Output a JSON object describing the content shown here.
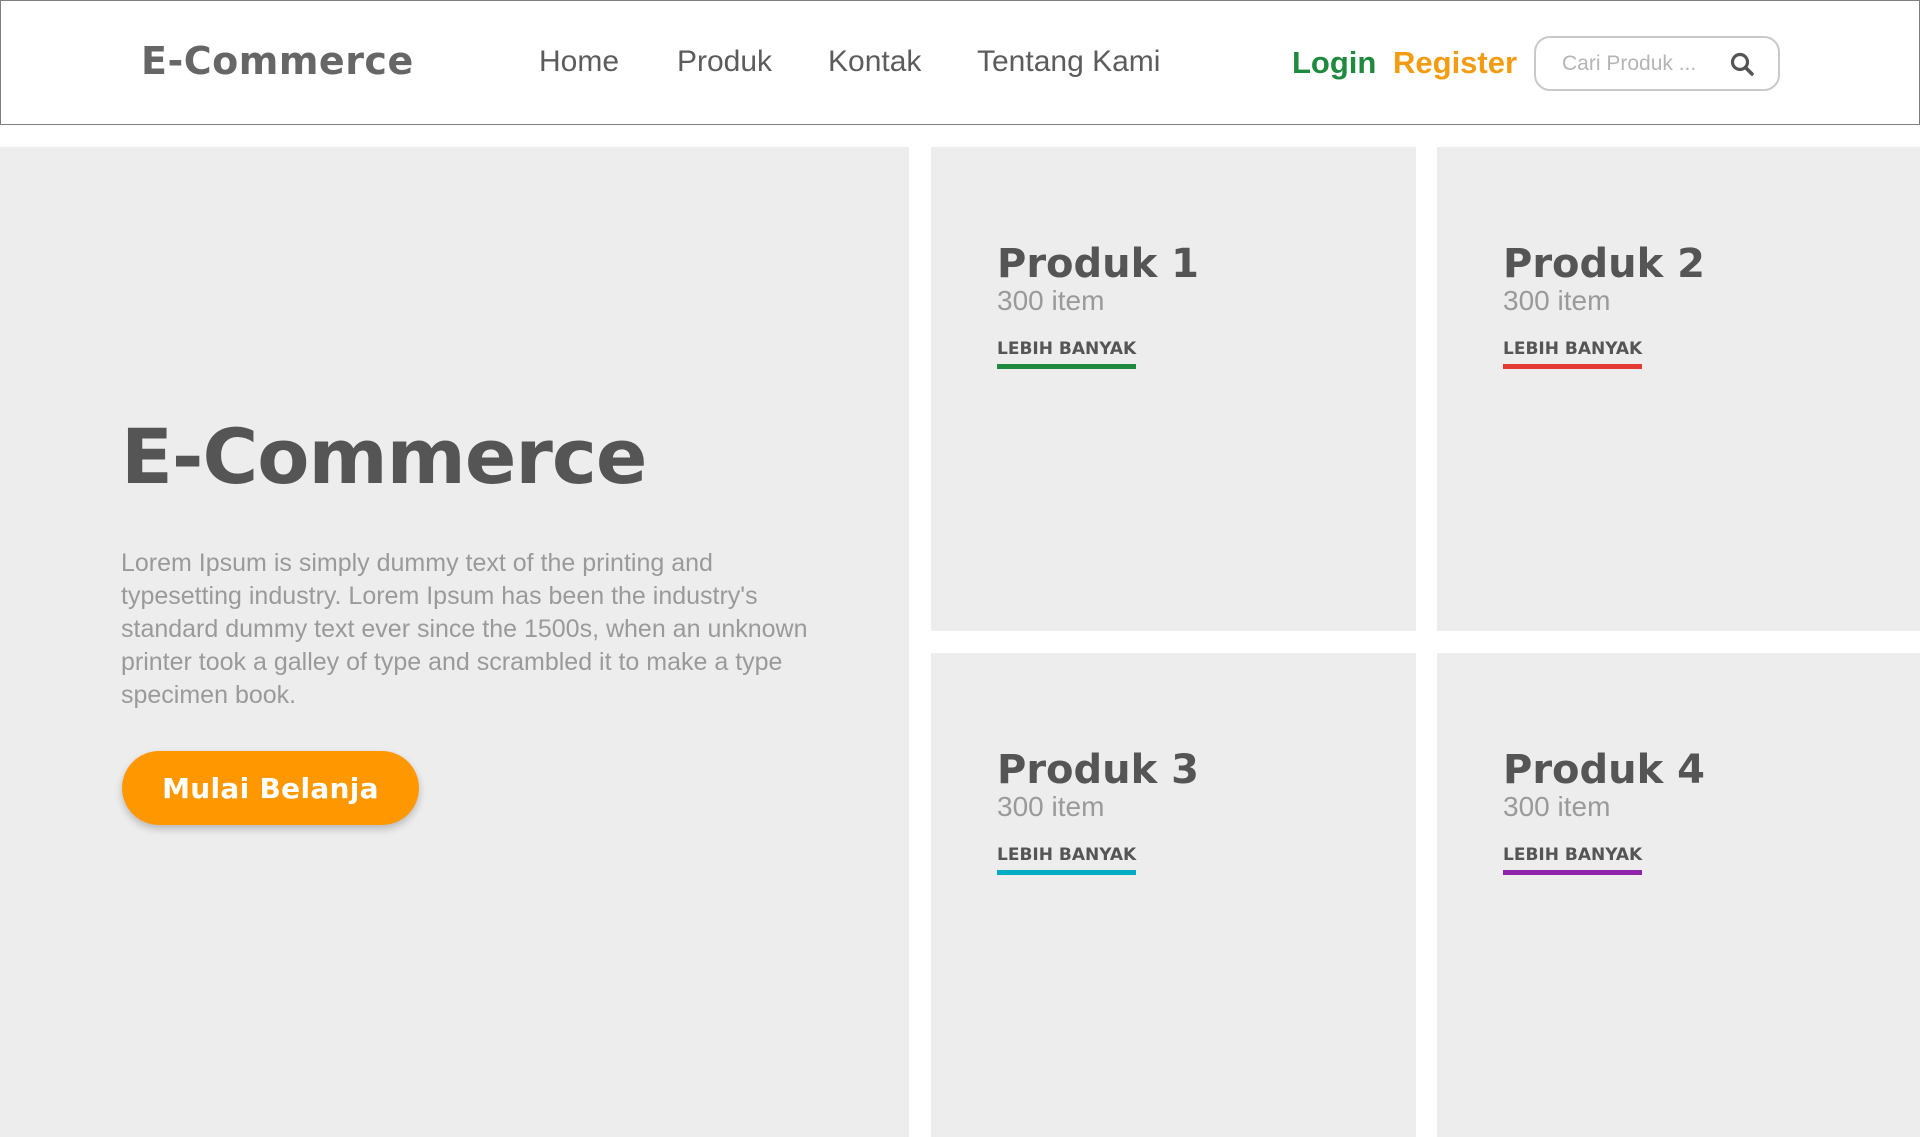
{
  "header": {
    "logo": "E-Commerce",
    "nav": [
      {
        "label": "Home"
      },
      {
        "label": "Produk"
      },
      {
        "label": "Kontak"
      },
      {
        "label": "Tentang Kami"
      }
    ],
    "login_label": "Login",
    "register_label": "Register",
    "search": {
      "placeholder": "Cari Produk ...",
      "icon": "search-icon"
    }
  },
  "hero": {
    "title": "E-Commerce",
    "description": "Lorem Ipsum is simply dummy text of the printing and typesetting industry. Lorem Ipsum has been the industry's standard dummy text ever since the 1500s, when an unknown printer took a galley of type and scrambled it to make a type specimen book.",
    "button_label": "Mulai Belanja"
  },
  "products": [
    {
      "title": "Produk 1",
      "count": "300 item",
      "link": "LEBIH BANYAK",
      "accent": "#1f8a3e"
    },
    {
      "title": "Produk 2",
      "count": "300 item",
      "link": "LEBIH BANYAK",
      "accent": "#e53935"
    },
    {
      "title": "Produk 3",
      "count": "300 item",
      "link": "LEBIH BANYAK",
      "accent": "#00acc1"
    },
    {
      "title": "Produk 4",
      "count": "300 item",
      "link": "LEBIH BANYAK",
      "accent": "#8e24aa"
    }
  ],
  "colors": {
    "login": "#1f8a3e",
    "register": "#f39c12",
    "primary_button": "#ff9800",
    "panel_bg": "#ededed"
  }
}
